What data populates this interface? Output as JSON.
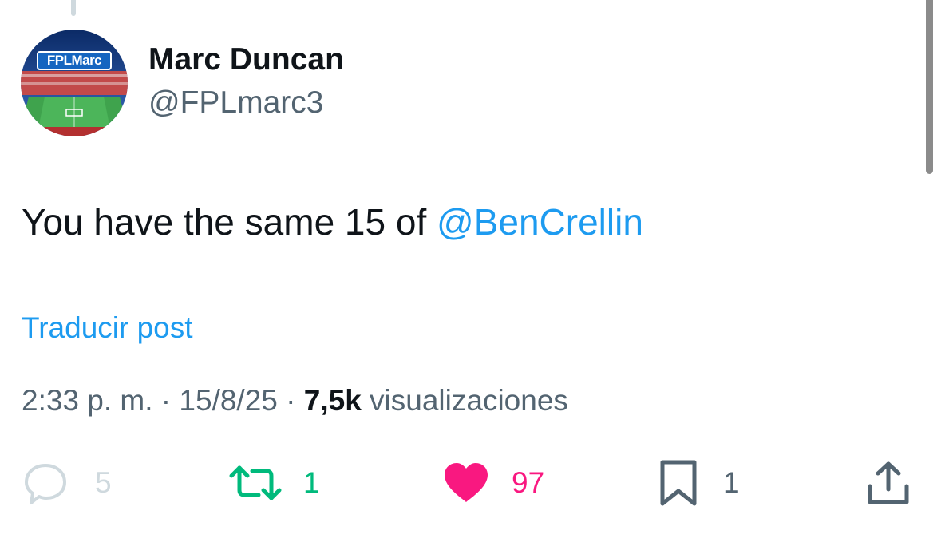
{
  "author": {
    "display_name": "Marc Duncan",
    "handle": "@FPLmarc3",
    "avatar_label": "FPLMarc"
  },
  "tweet": {
    "text": "You have the same 15 of ",
    "mention": "@BenCrellin"
  },
  "translate_label": "Traducir post",
  "meta": {
    "time": "2:33 p. m.",
    "separator": " · ",
    "date": "15/8/25",
    "views_count": "7,5k",
    "views_label": " visualizaciones"
  },
  "actions": {
    "replies": "5",
    "reposts": "1",
    "likes": "97",
    "bookmarks": "1"
  },
  "colors": {
    "link": "#1d9bf0",
    "repost": "#00ba7c",
    "like": "#f91880",
    "secondary_text": "#536471"
  },
  "icons": [
    "reply-icon",
    "repost-icon",
    "heart-icon",
    "bookmark-icon",
    "share-icon"
  ]
}
